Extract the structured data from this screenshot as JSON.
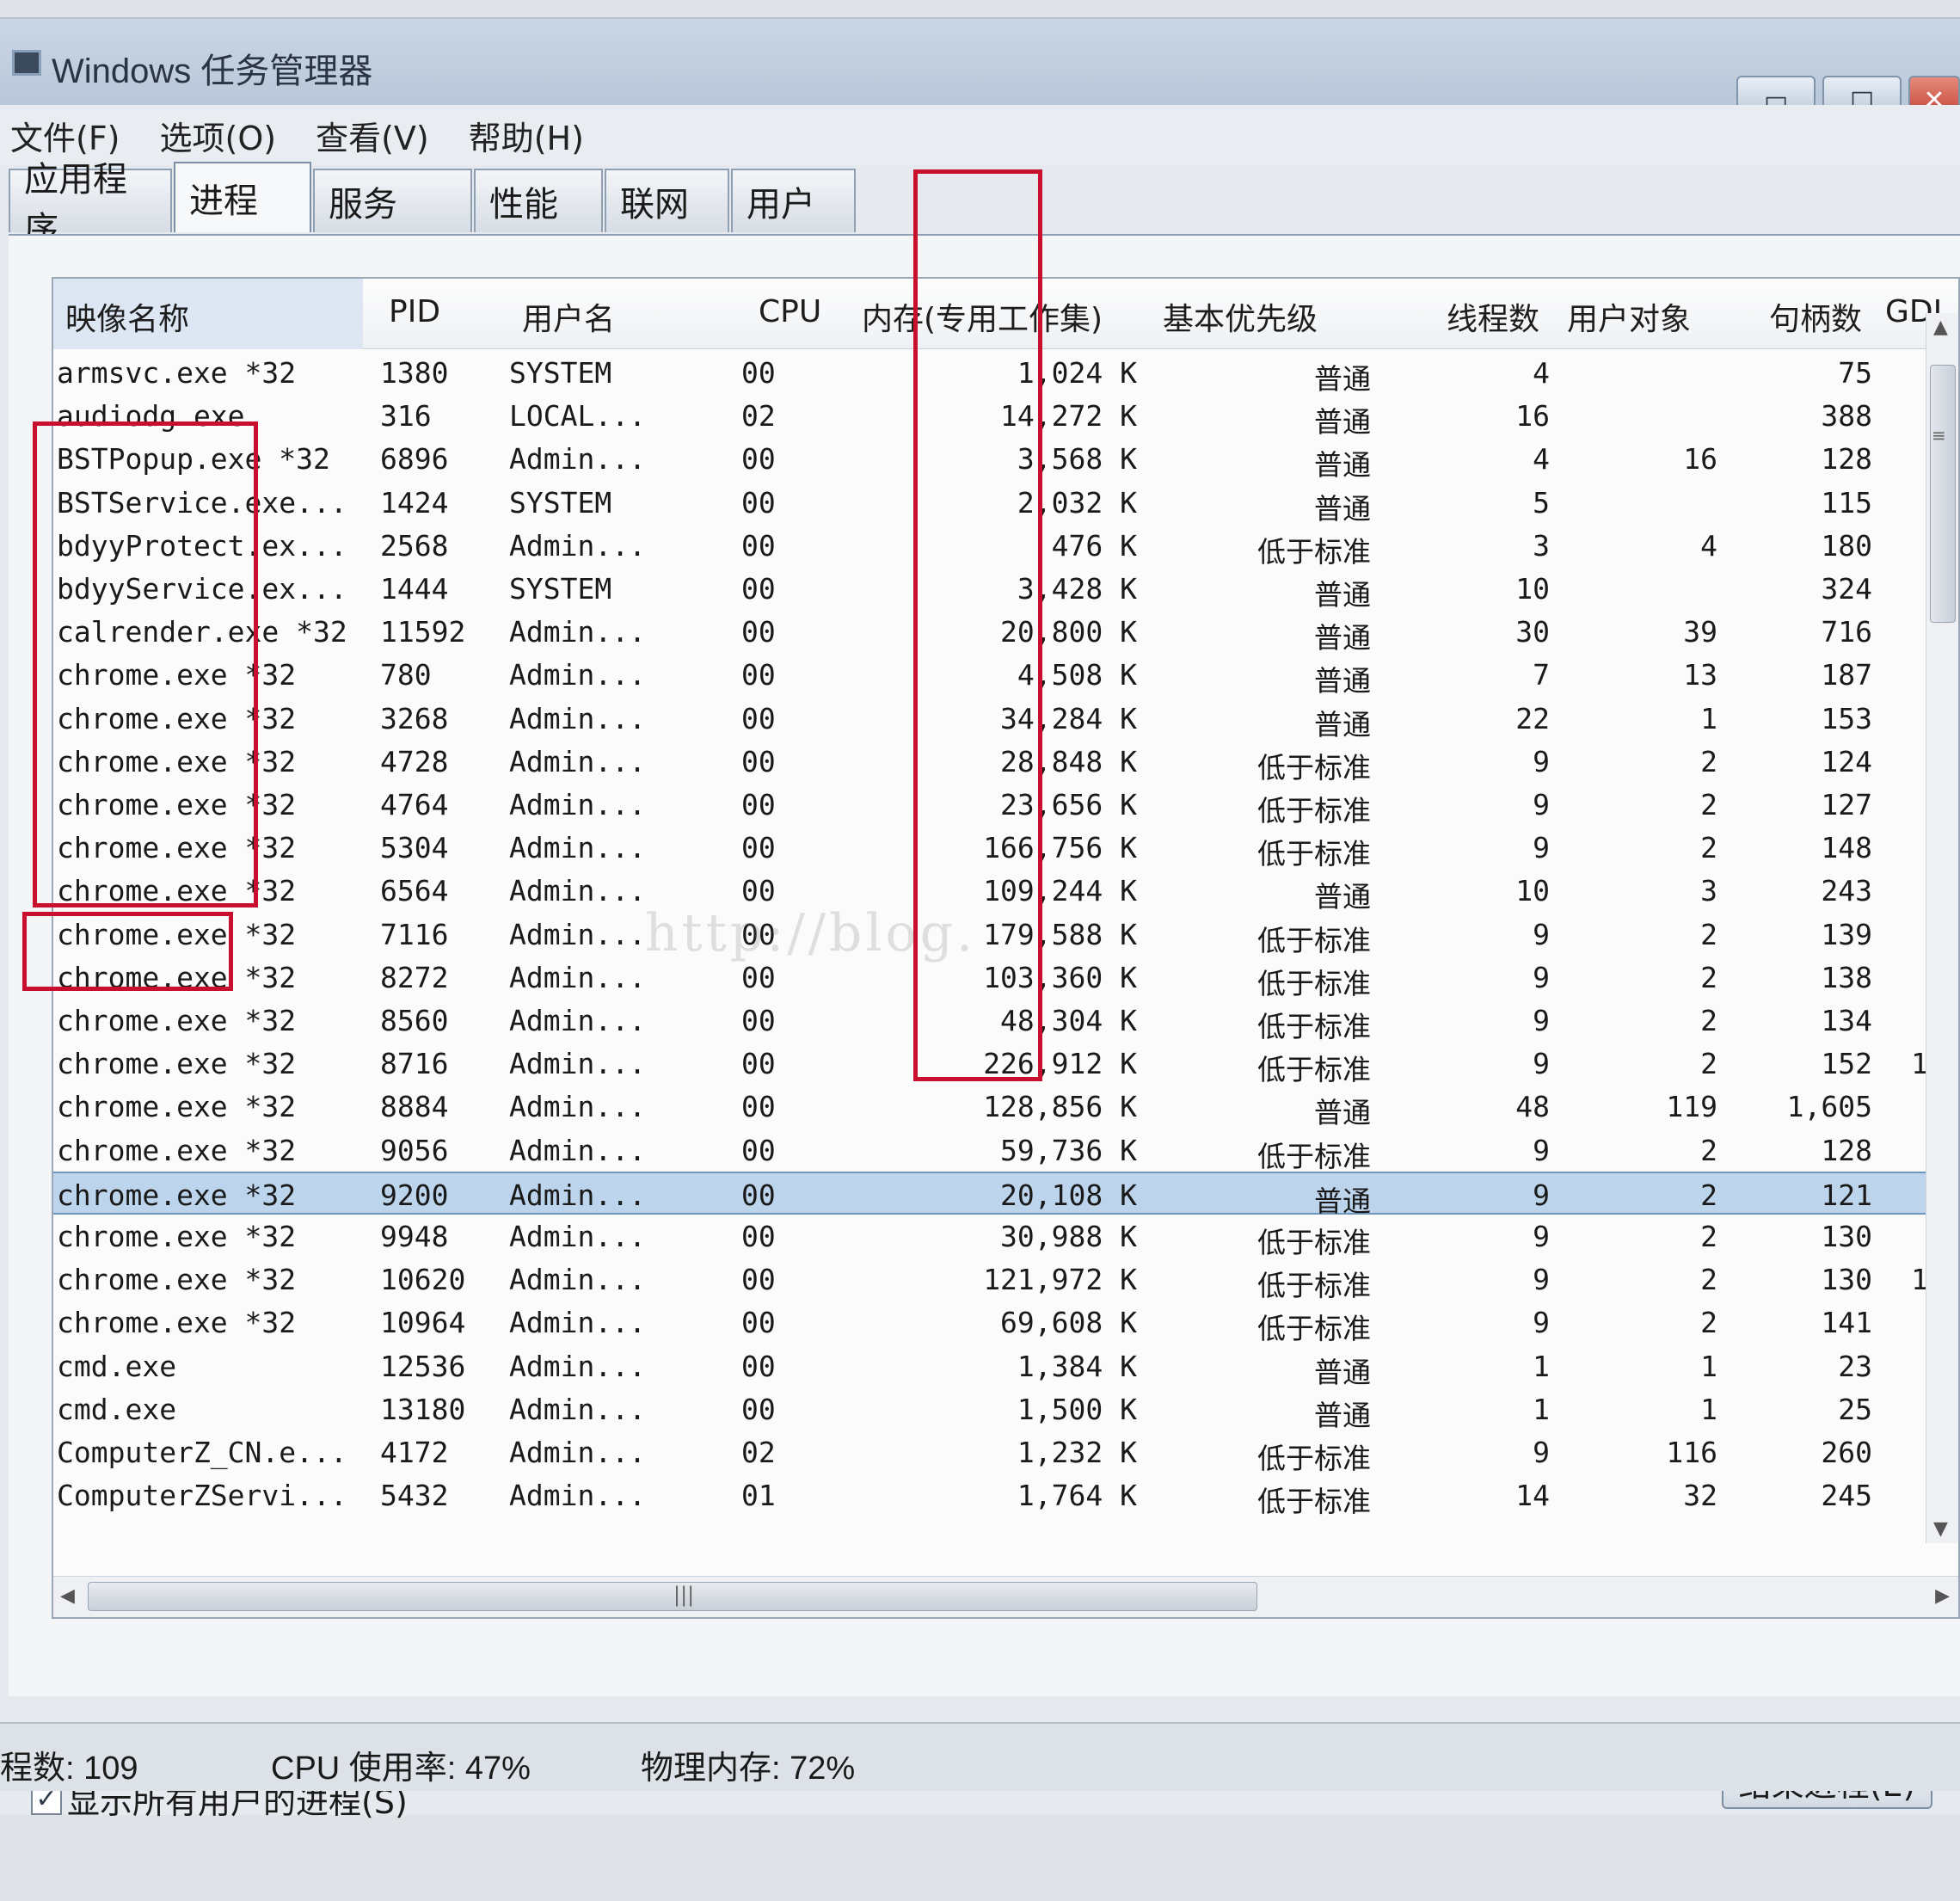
{
  "window": {
    "title": "Windows 任务管理器",
    "min_glyph": "▭",
    "max_glyph": "□",
    "close_glyph": "✕"
  },
  "menu": {
    "items": [
      "文件(F)",
      "选项(O)",
      "查看(V)",
      "帮助(H)"
    ]
  },
  "tabs": {
    "items": [
      "应用程序",
      "进程",
      "服务",
      "性能",
      "联网",
      "用户"
    ],
    "active": "进程"
  },
  "table": {
    "columns": {
      "name": "映像名称",
      "pid": "PID",
      "user": "用户名",
      "cpu": "CPU",
      "mem": "内存(专用工作集)",
      "priority": "基本优先级",
      "threads": "线程数",
      "user_objects": "用户对象",
      "handles": "句柄数",
      "gdi": "GDI"
    },
    "rows": [
      {
        "name": "armsvc.exe *32",
        "pid": "1380",
        "user": "SYSTEM",
        "cpu": "00",
        "mem": "1,024 K",
        "priority": "普通",
        "threads": "4",
        "user_objects": "",
        "handles": "75",
        "gdi": ""
      },
      {
        "name": "audiodg.exe",
        "pid": "316",
        "user": "LOCAL...",
        "cpu": "02",
        "mem": "14,272 K",
        "priority": "普通",
        "threads": "16",
        "user_objects": "",
        "handles": "388",
        "gdi": ""
      },
      {
        "name": "BSTPopup.exe *32",
        "pid": "6896",
        "user": "Admin...",
        "cpu": "00",
        "mem": "3,568 K",
        "priority": "普通",
        "threads": "4",
        "user_objects": "16",
        "handles": "128",
        "gdi": ""
      },
      {
        "name": "BSTService.exe...",
        "pid": "1424",
        "user": "SYSTEM",
        "cpu": "00",
        "mem": "2,032 K",
        "priority": "普通",
        "threads": "5",
        "user_objects": "",
        "handles": "115",
        "gdi": ""
      },
      {
        "name": "bdyyProtect.ex...",
        "pid": "2568",
        "user": "Admin...",
        "cpu": "00",
        "mem": "476 K",
        "priority": "低于标准",
        "threads": "3",
        "user_objects": "4",
        "handles": "180",
        "gdi": ""
      },
      {
        "name": "bdyyService.ex...",
        "pid": "1444",
        "user": "SYSTEM",
        "cpu": "00",
        "mem": "3,428 K",
        "priority": "普通",
        "threads": "10",
        "user_objects": "",
        "handles": "324",
        "gdi": ""
      },
      {
        "name": "calrender.exe *32",
        "pid": "11592",
        "user": "Admin...",
        "cpu": "00",
        "mem": "20,800 K",
        "priority": "普通",
        "threads": "30",
        "user_objects": "39",
        "handles": "716",
        "gdi": ""
      },
      {
        "name": "chrome.exe *32",
        "pid": "780",
        "user": "Admin...",
        "cpu": "00",
        "mem": "4,508 K",
        "priority": "普通",
        "threads": "7",
        "user_objects": "13",
        "handles": "187",
        "gdi": ""
      },
      {
        "name": "chrome.exe *32",
        "pid": "3268",
        "user": "Admin...",
        "cpu": "00",
        "mem": "34,284 K",
        "priority": "普通",
        "threads": "22",
        "user_objects": "1",
        "handles": "153",
        "gdi": ""
      },
      {
        "name": "chrome.exe *32",
        "pid": "4728",
        "user": "Admin...",
        "cpu": "00",
        "mem": "28,848 K",
        "priority": "低于标准",
        "threads": "9",
        "user_objects": "2",
        "handles": "124",
        "gdi": ""
      },
      {
        "name": "chrome.exe *32",
        "pid": "4764",
        "user": "Admin...",
        "cpu": "00",
        "mem": "23,656 K",
        "priority": "低于标准",
        "threads": "9",
        "user_objects": "2",
        "handles": "127",
        "gdi": ""
      },
      {
        "name": "chrome.exe *32",
        "pid": "5304",
        "user": "Admin...",
        "cpu": "00",
        "mem": "166,756 K",
        "priority": "低于标准",
        "threads": "9",
        "user_objects": "2",
        "handles": "148",
        "gdi": ""
      },
      {
        "name": "chrome.exe *32",
        "pid": "6564",
        "user": "Admin...",
        "cpu": "00",
        "mem": "109,244 K",
        "priority": "普通",
        "threads": "10",
        "user_objects": "3",
        "handles": "243",
        "gdi": ""
      },
      {
        "name": "chrome.exe *32",
        "pid": "7116",
        "user": "Admin...",
        "cpu": "00",
        "mem": "179,588 K",
        "priority": "低于标准",
        "threads": "9",
        "user_objects": "2",
        "handles": "139",
        "gdi": ""
      },
      {
        "name": "chrome.exe *32",
        "pid": "8272",
        "user": "Admin...",
        "cpu": "00",
        "mem": "103,360 K",
        "priority": "低于标准",
        "threads": "9",
        "user_objects": "2",
        "handles": "138",
        "gdi": ""
      },
      {
        "name": "chrome.exe *32",
        "pid": "8560",
        "user": "Admin...",
        "cpu": "00",
        "mem": "48,304 K",
        "priority": "低于标准",
        "threads": "9",
        "user_objects": "2",
        "handles": "134",
        "gdi": ""
      },
      {
        "name": "chrome.exe *32",
        "pid": "8716",
        "user": "Admin...",
        "cpu": "00",
        "mem": "226,912 K",
        "priority": "低于标准",
        "threads": "9",
        "user_objects": "2",
        "handles": "152",
        "gdi": "1"
      },
      {
        "name": "chrome.exe *32",
        "pid": "8884",
        "user": "Admin...",
        "cpu": "00",
        "mem": "128,856 K",
        "priority": "普通",
        "threads": "48",
        "user_objects": "119",
        "handles": "1,605",
        "gdi": ""
      },
      {
        "name": "chrome.exe *32",
        "pid": "9056",
        "user": "Admin...",
        "cpu": "00",
        "mem": "59,736 K",
        "priority": "低于标准",
        "threads": "9",
        "user_objects": "2",
        "handles": "128",
        "gdi": ""
      },
      {
        "name": "chrome.exe *32",
        "pid": "9200",
        "user": "Admin...",
        "cpu": "00",
        "mem": "20,108 K",
        "priority": "普通",
        "threads": "9",
        "user_objects": "2",
        "handles": "121",
        "gdi": "",
        "selected": true
      },
      {
        "name": "chrome.exe *32",
        "pid": "9948",
        "user": "Admin...",
        "cpu": "00",
        "mem": "30,988 K",
        "priority": "低于标准",
        "threads": "9",
        "user_objects": "2",
        "handles": "130",
        "gdi": ""
      },
      {
        "name": "chrome.exe *32",
        "pid": "10620",
        "user": "Admin...",
        "cpu": "00",
        "mem": "121,972 K",
        "priority": "低于标准",
        "threads": "9",
        "user_objects": "2",
        "handles": "130",
        "gdi": "1"
      },
      {
        "name": "chrome.exe *32",
        "pid": "10964",
        "user": "Admin...",
        "cpu": "00",
        "mem": "69,608 K",
        "priority": "低于标准",
        "threads": "9",
        "user_objects": "2",
        "handles": "141",
        "gdi": ""
      },
      {
        "name": "cmd.exe",
        "pid": "12536",
        "user": "Admin...",
        "cpu": "00",
        "mem": "1,384 K",
        "priority": "普通",
        "threads": "1",
        "user_objects": "1",
        "handles": "23",
        "gdi": ""
      },
      {
        "name": "cmd.exe",
        "pid": "13180",
        "user": "Admin...",
        "cpu": "00",
        "mem": "1,500 K",
        "priority": "普通",
        "threads": "1",
        "user_objects": "1",
        "handles": "25",
        "gdi": ""
      },
      {
        "name": "ComputerZ_CN.e...",
        "pid": "4172",
        "user": "Admin...",
        "cpu": "02",
        "mem": "1,232 K",
        "priority": "低于标准",
        "threads": "9",
        "user_objects": "116",
        "handles": "260",
        "gdi": ""
      },
      {
        "name": "ComputerZServi...",
        "pid": "5432",
        "user": "Admin...",
        "cpu": "01",
        "mem": "1,764 K",
        "priority": "低于标准",
        "threads": "14",
        "user_objects": "32",
        "handles": "245",
        "gdi": ""
      }
    ]
  },
  "bottom": {
    "show_all_label": "显示所有用户的进程(S)",
    "show_all_checked": true,
    "end_process_label": "结束进程(E)"
  },
  "status": {
    "processes": "程数: 109",
    "cpu": "CPU 使用率: 47%",
    "memory": "物理内存: 72%"
  },
  "watermark": "http://blog.",
  "colors": {
    "highlight_red": "#c8102e",
    "selected_row": "#bcd4ec"
  }
}
